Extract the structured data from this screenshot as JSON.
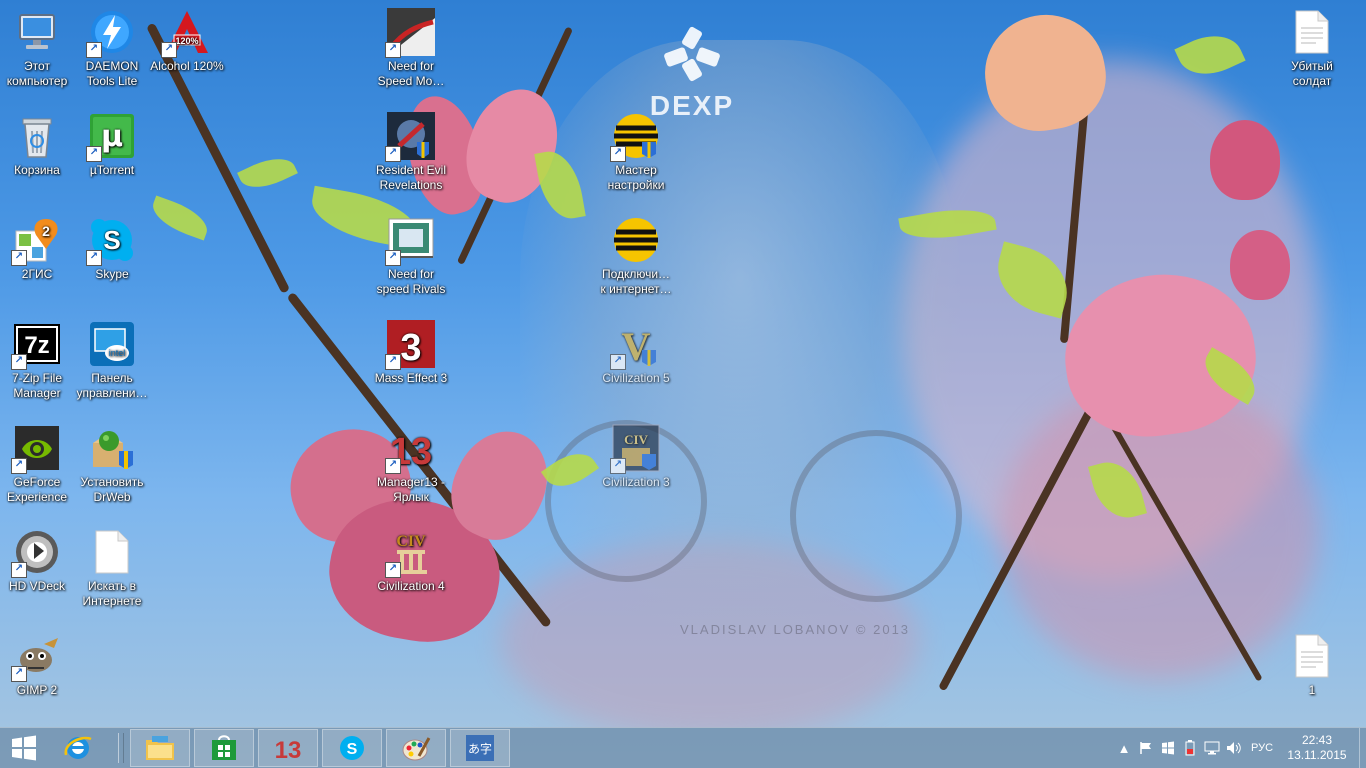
{
  "desktop": {
    "icons": [
      {
        "id": "this-pc",
        "label": "Этот компьютер",
        "icon": "computer-icon"
      },
      {
        "id": "daemon",
        "label": "DAEMON Tools Lite",
        "icon": "daemon-tools-icon"
      },
      {
        "id": "alcohol",
        "label": "Alcohol 120%",
        "icon": "alcohol-icon",
        "badge": "120%"
      },
      {
        "id": "nfs-most-wanted",
        "label": "Need for Speed Mo…",
        "icon": "need-for-speed-icon"
      },
      {
        "id": "killed-soldier",
        "label": "Убитый солдат",
        "icon": "document-icon"
      },
      {
        "id": "recycle",
        "label": "Корзина",
        "icon": "recycle-bin-icon"
      },
      {
        "id": "utorrent",
        "label": "µTorrent",
        "icon": "utorrent-icon",
        "glyph": "µ"
      },
      {
        "id": "resident-evil",
        "label": "Resident Evil Revelations",
        "icon": "resident-evil-icon"
      },
      {
        "id": "beeline-setup",
        "label": "Мастер настройки",
        "icon": "beeline-icon"
      },
      {
        "id": "2gis",
        "label": "2ГИС",
        "icon": "2gis-icon",
        "glyph": "2"
      },
      {
        "id": "skype",
        "label": "Skype",
        "icon": "skype-icon",
        "glyph": "S"
      },
      {
        "id": "nfs-rivals",
        "label": "Need for speed Rivals",
        "icon": "need-for-speed-rivals-icon"
      },
      {
        "id": "beeline-connect",
        "label": "Подключи… к интернет…",
        "icon": "beeline-icon"
      },
      {
        "id": "7zip",
        "label": "7-Zip File Manager",
        "icon": "7zip-icon",
        "glyph": "7z"
      },
      {
        "id": "intel-panel",
        "label": "Панель управлени…",
        "icon": "intel-icon",
        "glyph": "intel"
      },
      {
        "id": "mass-effect",
        "label": "Mass Effect 3",
        "icon": "mass-effect-icon",
        "glyph": "3"
      },
      {
        "id": "civ5",
        "label": "Civilization 5",
        "icon": "civilization-5-icon",
        "glyph": "V"
      },
      {
        "id": "geforce",
        "label": "GeForce Experience",
        "icon": "geforce-icon"
      },
      {
        "id": "drweb",
        "label": "Установить DrWeb",
        "icon": "drweb-icon"
      },
      {
        "id": "manager13",
        "label": "Manager13 - Ярлык",
        "icon": "manager13-icon",
        "glyph": "13"
      },
      {
        "id": "civ3",
        "label": "Civilization 3",
        "icon": "civilization-3-icon",
        "glyph": "CIV"
      },
      {
        "id": "hdvdeck",
        "label": "HD VDeck",
        "icon": "hd-vdeck-icon"
      },
      {
        "id": "search-internet",
        "label": "Искать в Интернете",
        "icon": "document-icon"
      },
      {
        "id": "civ4",
        "label": "Civilization 4",
        "icon": "civilization-4-icon",
        "glyph": "CIV"
      },
      {
        "id": "gimp",
        "label": "GIMP 2",
        "icon": "gimp-icon"
      },
      {
        "id": "file-1",
        "label": "1",
        "icon": "document-icon"
      }
    ]
  },
  "wallpaper": {
    "brand": "DEXP",
    "watermark": "VLADISLAV LOBANOV © 2013"
  },
  "taskbar": {
    "pinned": [
      {
        "id": "ie",
        "icon": "internet-explorer-icon",
        "glyph": "e"
      },
      {
        "id": "explorer",
        "icon": "file-explorer-icon"
      },
      {
        "id": "store",
        "icon": "store-icon"
      },
      {
        "id": "manager13",
        "icon": "manager13-icon",
        "glyph": "13"
      },
      {
        "id": "skype",
        "icon": "skype-icon",
        "glyph": "S"
      },
      {
        "id": "paint",
        "icon": "paint-icon"
      },
      {
        "id": "ime",
        "icon": "language-ime-icon",
        "glyph": "あ字"
      }
    ],
    "tray": {
      "language": "РУС",
      "time": "22:43",
      "date": "13.11.2015"
    }
  },
  "colors": {
    "taskbar_bg": "#5a7896",
    "accent": "#1e73d0"
  }
}
